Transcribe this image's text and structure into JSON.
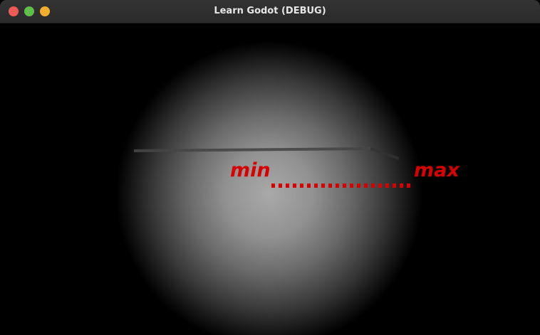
{
  "window": {
    "title": "Learn Godot (DEBUG)",
    "controls": [
      "close",
      "minimize",
      "maximize"
    ]
  },
  "scene": {
    "min_label": "min",
    "max_label": "max",
    "label_color": "#d80000",
    "background_color": "#000000"
  }
}
